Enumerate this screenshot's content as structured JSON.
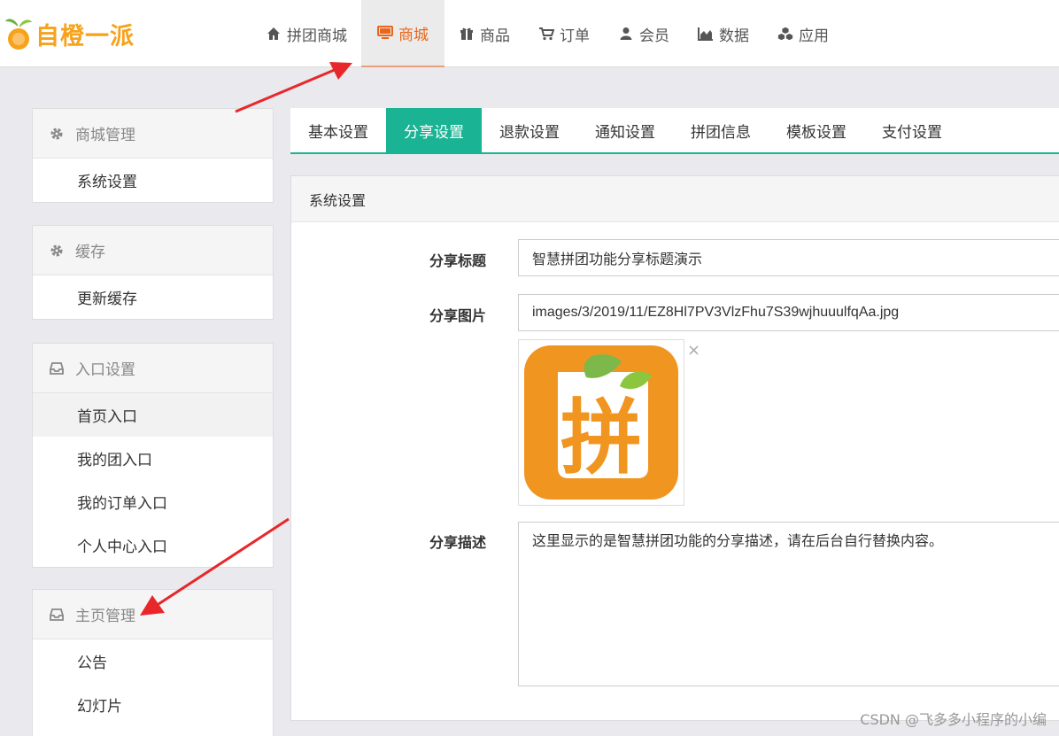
{
  "brand": {
    "name": "自橙一派"
  },
  "nav": [
    {
      "label": "拼团商城",
      "icon": "home-icon",
      "active": false
    },
    {
      "label": "商城",
      "icon": "monitor-icon",
      "active": true
    },
    {
      "label": "商品",
      "icon": "gift-icon",
      "active": false
    },
    {
      "label": "订单",
      "icon": "cart-icon",
      "active": false
    },
    {
      "label": "会员",
      "icon": "user-icon",
      "active": false
    },
    {
      "label": "数据",
      "icon": "area-chart-icon",
      "active": false
    },
    {
      "label": "应用",
      "icon": "cubes-icon",
      "active": false
    }
  ],
  "sidebar": {
    "groups": [
      {
        "title": "商城管理",
        "icon": "gear-icon",
        "items": [
          "系统设置"
        ]
      },
      {
        "title": "缓存",
        "icon": "gear-icon",
        "items": [
          "更新缓存"
        ]
      },
      {
        "title": "入口设置",
        "icon": "inbox-icon",
        "items": [
          "首页入口",
          "我的团入口",
          "我的订单入口",
          "个人中心入口"
        ]
      },
      {
        "title": "主页管理",
        "icon": "inbox-icon",
        "items": [
          "公告",
          "幻灯片"
        ]
      }
    ]
  },
  "tabs": [
    {
      "label": "基本设置",
      "active": false
    },
    {
      "label": "分享设置",
      "active": true
    },
    {
      "label": "退款设置",
      "active": false
    },
    {
      "label": "通知设置",
      "active": false
    },
    {
      "label": "拼团信息",
      "active": false
    },
    {
      "label": "模板设置",
      "active": false
    },
    {
      "label": "支付设置",
      "active": false
    }
  ],
  "form": {
    "title": "系统设置",
    "share_title_label": "分享标题",
    "share_title_value": "智慧拼团功能分享标题演示",
    "share_image_label": "分享图片",
    "share_image_value": "images/3/2019/11/EZ8Hl7PV3VlzFhu7S39wjhuuulfqAa.jpg",
    "share_image_glyph": "拼",
    "remove_label": "×",
    "share_desc_label": "分享描述",
    "share_desc_value": "这里显示的是智慧拼团功能的分享描述，请在后台自行替换内容。"
  },
  "watermark": "CSDN @飞多多小程序的小编",
  "colors": {
    "brand": "#f7a21b",
    "accent": "#1ab394",
    "nav_active": "#e8671c",
    "arrow": "#e8272a"
  }
}
